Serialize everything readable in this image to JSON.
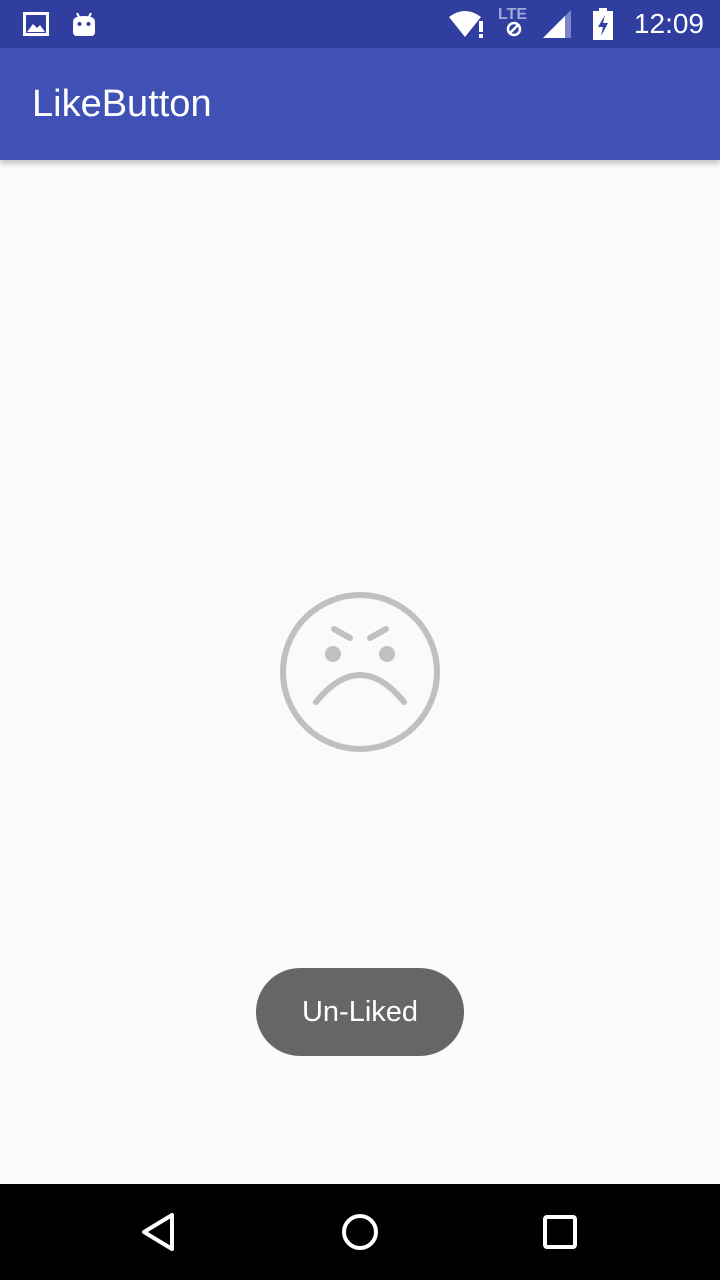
{
  "status_bar": {
    "time": "12:09",
    "network_label": "LTE",
    "icons": [
      "image-notification-icon",
      "android-notification-icon",
      "wifi-icon",
      "lte-icon",
      "cell-signal-icon",
      "battery-charging-icon"
    ]
  },
  "app_bar": {
    "title": "LikeButton"
  },
  "main": {
    "like_button": {
      "state": "unliked",
      "icon": "sad-face-icon",
      "color": "#c0c0c0"
    },
    "toast": {
      "message": "Un-Liked"
    }
  },
  "nav_bar": {
    "buttons": [
      "back-icon",
      "home-icon",
      "recents-icon"
    ]
  },
  "colors": {
    "status_bar": "#303f9f",
    "app_bar": "#3f51b5",
    "background": "#fafafa",
    "toast": "#666666",
    "nav_bar": "#000000"
  }
}
